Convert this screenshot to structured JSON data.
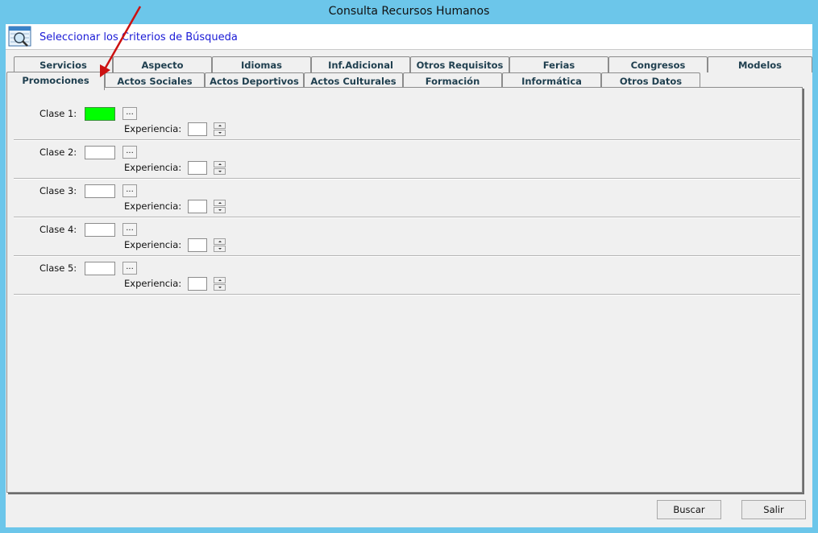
{
  "window": {
    "title": "Consulta Recursos Humanos"
  },
  "header": {
    "title": "Seleccionar los Criterios de Búsqueda"
  },
  "tabs_row1": [
    {
      "label": "Servicios"
    },
    {
      "label": "Aspecto"
    },
    {
      "label": "Idiomas"
    },
    {
      "label": "Inf.Adicional"
    },
    {
      "label": "Otros Requisitos"
    },
    {
      "label": "Ferias"
    },
    {
      "label": "Congresos"
    },
    {
      "label": "Modelos"
    }
  ],
  "tabs_row2": [
    {
      "label": "Promociones",
      "active": true
    },
    {
      "label": "Actos Sociales"
    },
    {
      "label": "Actos Deportivos"
    },
    {
      "label": "Actos Culturales"
    },
    {
      "label": "Formación"
    },
    {
      "label": "Informática"
    },
    {
      "label": "Otros Datos"
    }
  ],
  "clases": [
    {
      "label": "Clase 1:",
      "value": "",
      "highlight": true,
      "experiencia_label": "Experiencia:",
      "experiencia_value": ""
    },
    {
      "label": "Clase 2:",
      "value": "",
      "highlight": false,
      "experiencia_label": "Experiencia:",
      "experiencia_value": ""
    },
    {
      "label": "Clase 3:",
      "value": "",
      "highlight": false,
      "experiencia_label": "Experiencia:",
      "experiencia_value": ""
    },
    {
      "label": "Clase 4:",
      "value": "",
      "highlight": false,
      "experiencia_label": "Experiencia:",
      "experiencia_value": ""
    },
    {
      "label": "Clase 5:",
      "value": "",
      "highlight": false,
      "experiencia_label": "Experiencia:",
      "experiencia_value": ""
    }
  ],
  "browse_label": "...",
  "buttons": {
    "buscar": "Buscar",
    "salir": "Salir"
  },
  "colors": {
    "highlight": "#00ff00",
    "annotation_arrow": "#cc1111",
    "header_text": "#1a1ad6"
  },
  "icons": {
    "header": "search-criteria-icon",
    "annotation": "red-arrow-annotation"
  }
}
